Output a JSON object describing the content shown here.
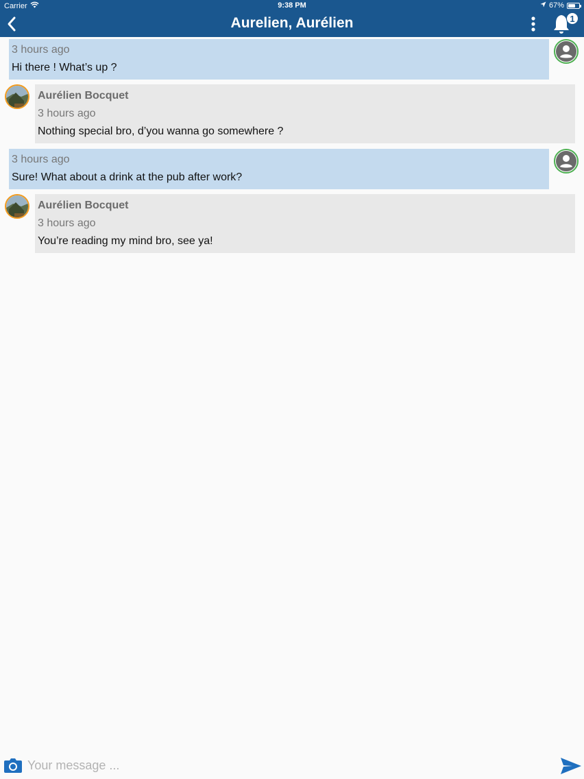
{
  "status_bar": {
    "carrier": "Carrier",
    "time": "9:38 PM",
    "battery_text": "67%",
    "battery_level": 0.67
  },
  "header": {
    "title": "Aurelien, Aurélien",
    "notification_count": "1",
    "accent_color": "#1a578f"
  },
  "messages": [
    {
      "direction": "outgoing",
      "time": "3 hours ago",
      "text": "Hi there ! What’s up ?"
    },
    {
      "direction": "incoming",
      "author": "Aurélien Bocquet",
      "time": "3 hours ago",
      "text": "Nothing special bro, d’you wanna go somewhere ?"
    },
    {
      "direction": "outgoing",
      "time": "3 hours ago",
      "text": "Sure! What about a drink at the pub after work?"
    },
    {
      "direction": "incoming",
      "author": "Aurélien Bocquet",
      "time": "3 hours ago",
      "text": "You’re reading my mind bro, see ya!"
    }
  ],
  "composer": {
    "placeholder": "Your message ...",
    "value": ""
  },
  "icons": {
    "back": "chevron-left-icon",
    "menu": "more-vertical-icon",
    "notifications": "bell-icon",
    "camera": "camera-icon",
    "send": "send-icon",
    "outgoing_avatar": "user-icon"
  }
}
